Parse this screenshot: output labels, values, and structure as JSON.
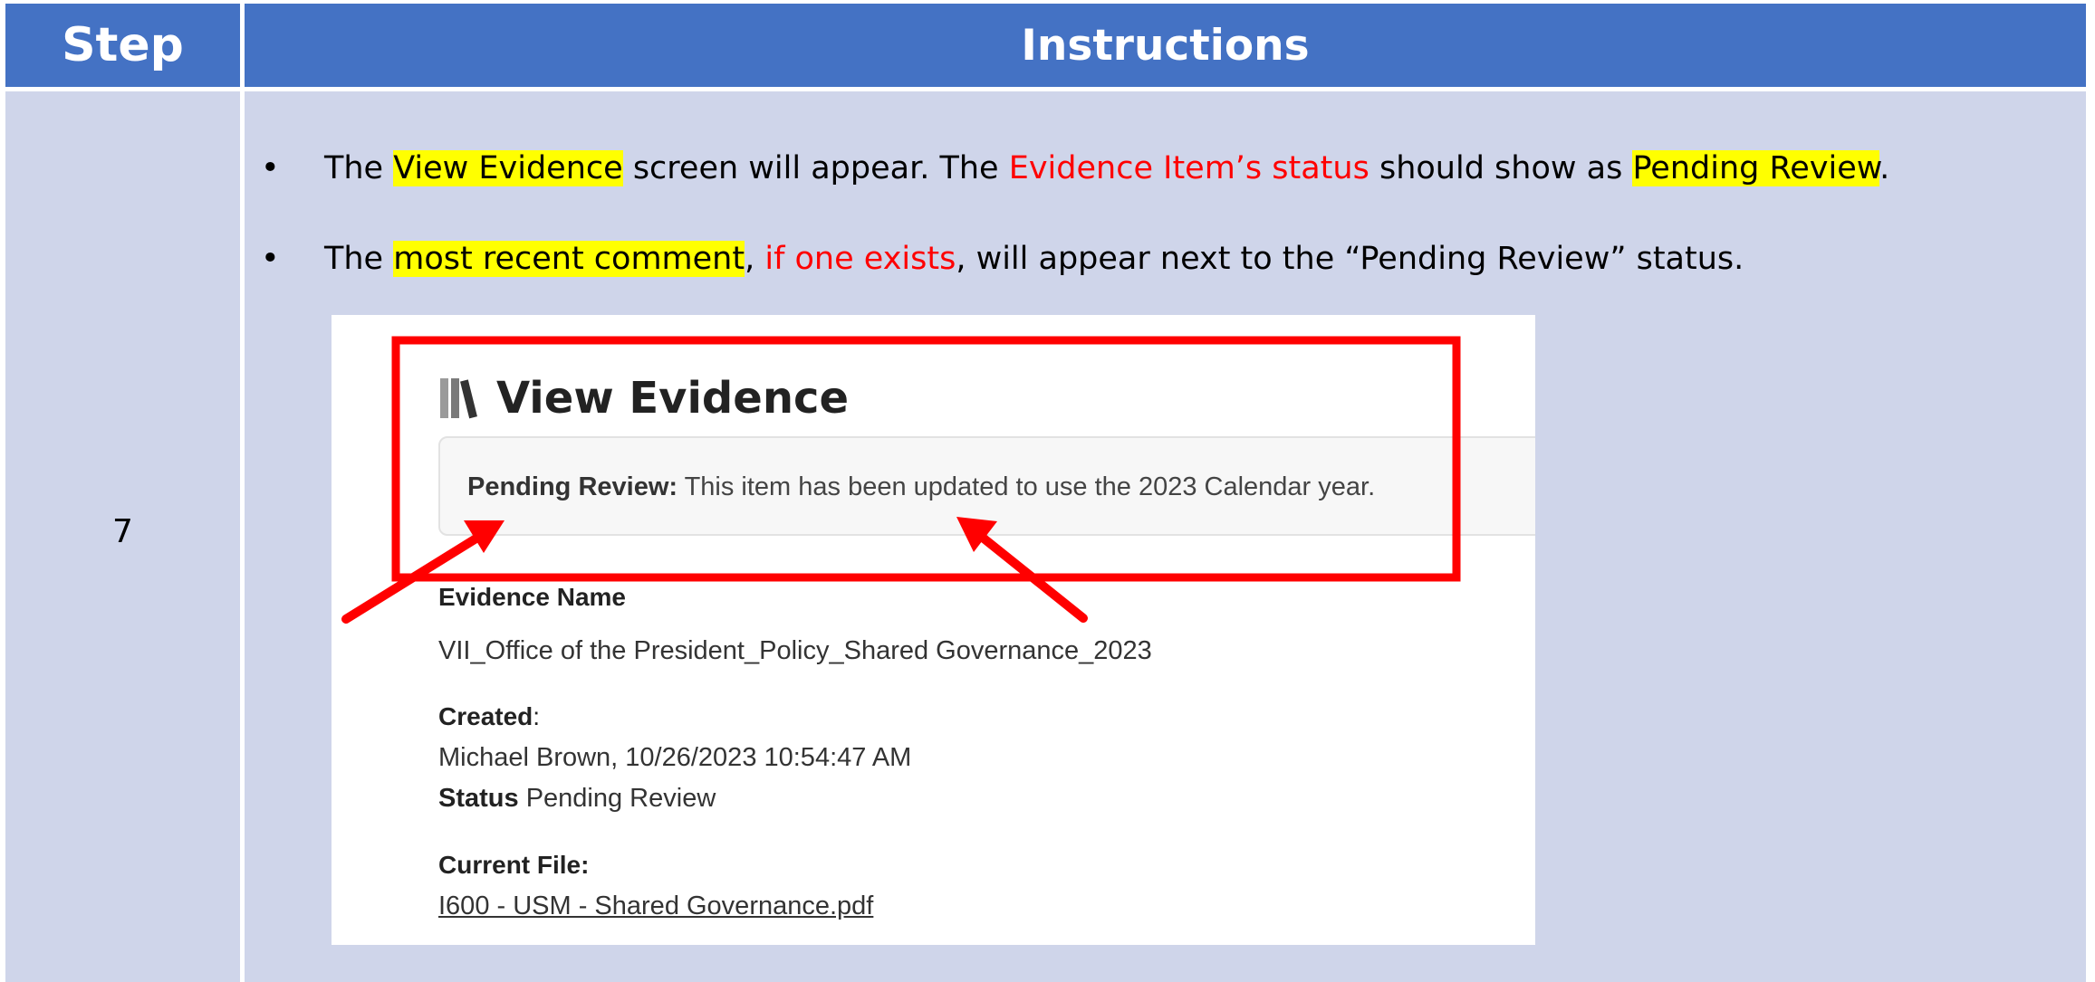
{
  "header": {
    "step": "Step",
    "instructions": "Instructions"
  },
  "row": {
    "step_number": "7",
    "bullets": [
      {
        "marker": "•",
        "parts": [
          {
            "text": "The ",
            "style": "normal"
          },
          {
            "text": "View Evidence",
            "style": "highlight"
          },
          {
            "text": " screen will appear.  The ",
            "style": "normal"
          },
          {
            "text": "Evidence Item’s status",
            "style": "red"
          },
          {
            "text": " should show as ",
            "style": "normal"
          },
          {
            "text": "Pending Review",
            "style": "highlight"
          },
          {
            "text": ".",
            "style": "normal"
          }
        ]
      },
      {
        "marker": "•",
        "parts": [
          {
            "text": "The ",
            "style": "normal"
          },
          {
            "text": "most recent comment",
            "style": "highlight"
          },
          {
            "text": ", ",
            "style": "normal"
          },
          {
            "text": "if one exists",
            "style": "red"
          },
          {
            "text": ", will appear next to the “Pending Review” status.",
            "style": "normal"
          }
        ]
      }
    ]
  },
  "screenshot": {
    "title": "View Evidence",
    "title_icon": "books-icon",
    "alert": {
      "label": "Pending Review:",
      "text": " This item has been updated to use the 2023 Calendar year."
    },
    "evidence_name_label": "Evidence Name",
    "evidence_name_value": "VII_Office of the President_Policy_Shared Governance_2023",
    "created_label": "Created",
    "created_colon": ":",
    "created_value": "Michael Brown, 10/26/2023 10:54:47 AM",
    "status_label": "Status",
    "status_value": " Pending Review",
    "current_file_label": "Current File:",
    "current_file_link": "I600 - USM - Shared Governance.pdf"
  },
  "colors": {
    "header_bg": "#4472c4",
    "cell_bg": "#cfd5ea",
    "highlight": "#ffff00",
    "emphasis_red": "#ff0000",
    "callout_red": "#ff0000"
  }
}
